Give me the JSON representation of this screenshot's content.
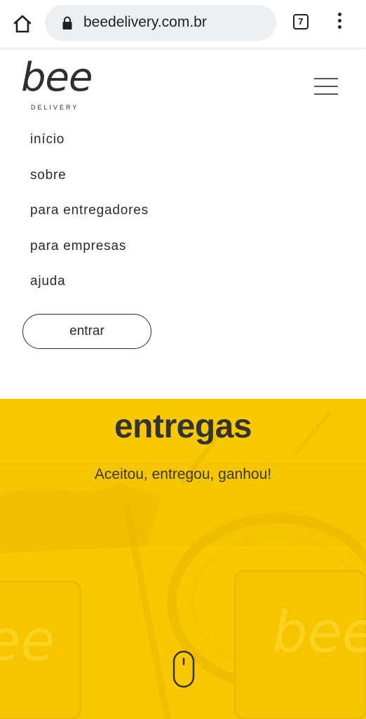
{
  "browser": {
    "url": "beedelivery.com.br",
    "tab_count": "7",
    "icons": {
      "home": "home-icon",
      "lock": "lock-icon",
      "menu": "more-vert-icon"
    }
  },
  "site": {
    "logo": {
      "word": "bee",
      "sub": "DELIVERY"
    },
    "nav": [
      {
        "label": "início"
      },
      {
        "label": "sobre"
      },
      {
        "label": "para entregadores"
      },
      {
        "label": "para empresas"
      },
      {
        "label": "ajuda"
      }
    ],
    "enter_label": "entrar"
  },
  "hero": {
    "title": "entregas",
    "subtitle": "Aceitou, entregou, ganhou!",
    "accent": "#f8c800",
    "scroll_icon": "mouse-scroll-icon"
  }
}
